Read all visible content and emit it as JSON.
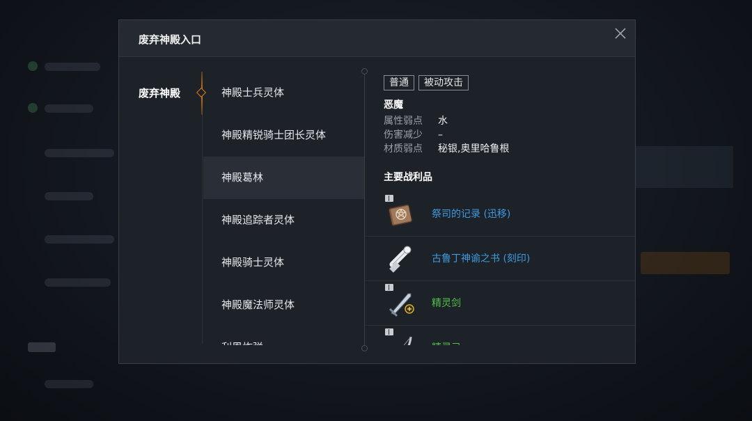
{
  "dialog": {
    "title": "废弃神殿入口",
    "close_label": "close"
  },
  "category": {
    "label": "废弃神殿"
  },
  "monsters": [
    {
      "label": "神殿士兵灵体"
    },
    {
      "label": "神殿精锐骑士团长灵体"
    },
    {
      "label": "神殿葛林"
    },
    {
      "label": "神殿追踪者灵体"
    },
    {
      "label": "神殿骑士灵体"
    },
    {
      "label": "神殿魔法师灵体"
    },
    {
      "label": "利恩炸弹"
    }
  ],
  "selected_index": 2,
  "detail": {
    "tags": [
      "普通",
      "被动攻击"
    ],
    "race": "恶魔",
    "attributes": [
      {
        "key": "属性弱点",
        "value": "水"
      },
      {
        "key": "伤害减少",
        "value": "–"
      },
      {
        "key": "材质弱点",
        "value": "秘银,奥里哈鲁根"
      }
    ],
    "loot_title": "主要战利品",
    "loot": [
      {
        "name": "祭司的记录 (迅移)",
        "rarity": "blue",
        "icon": "book-icon",
        "badge": true
      },
      {
        "name": "古鲁丁神谕之书 (刻印)",
        "rarity": "blue",
        "icon": "scroll-icon",
        "badge": false
      },
      {
        "name": "精灵剑",
        "rarity": "green",
        "icon": "sword-icon",
        "badge": true
      },
      {
        "name": "精灵弓",
        "rarity": "green",
        "icon": "bow-icon",
        "badge": true
      }
    ]
  },
  "colors": {
    "accent": "#e07a1a",
    "rarity_blue": "#3d9be0",
    "rarity_green": "#52c04a"
  }
}
